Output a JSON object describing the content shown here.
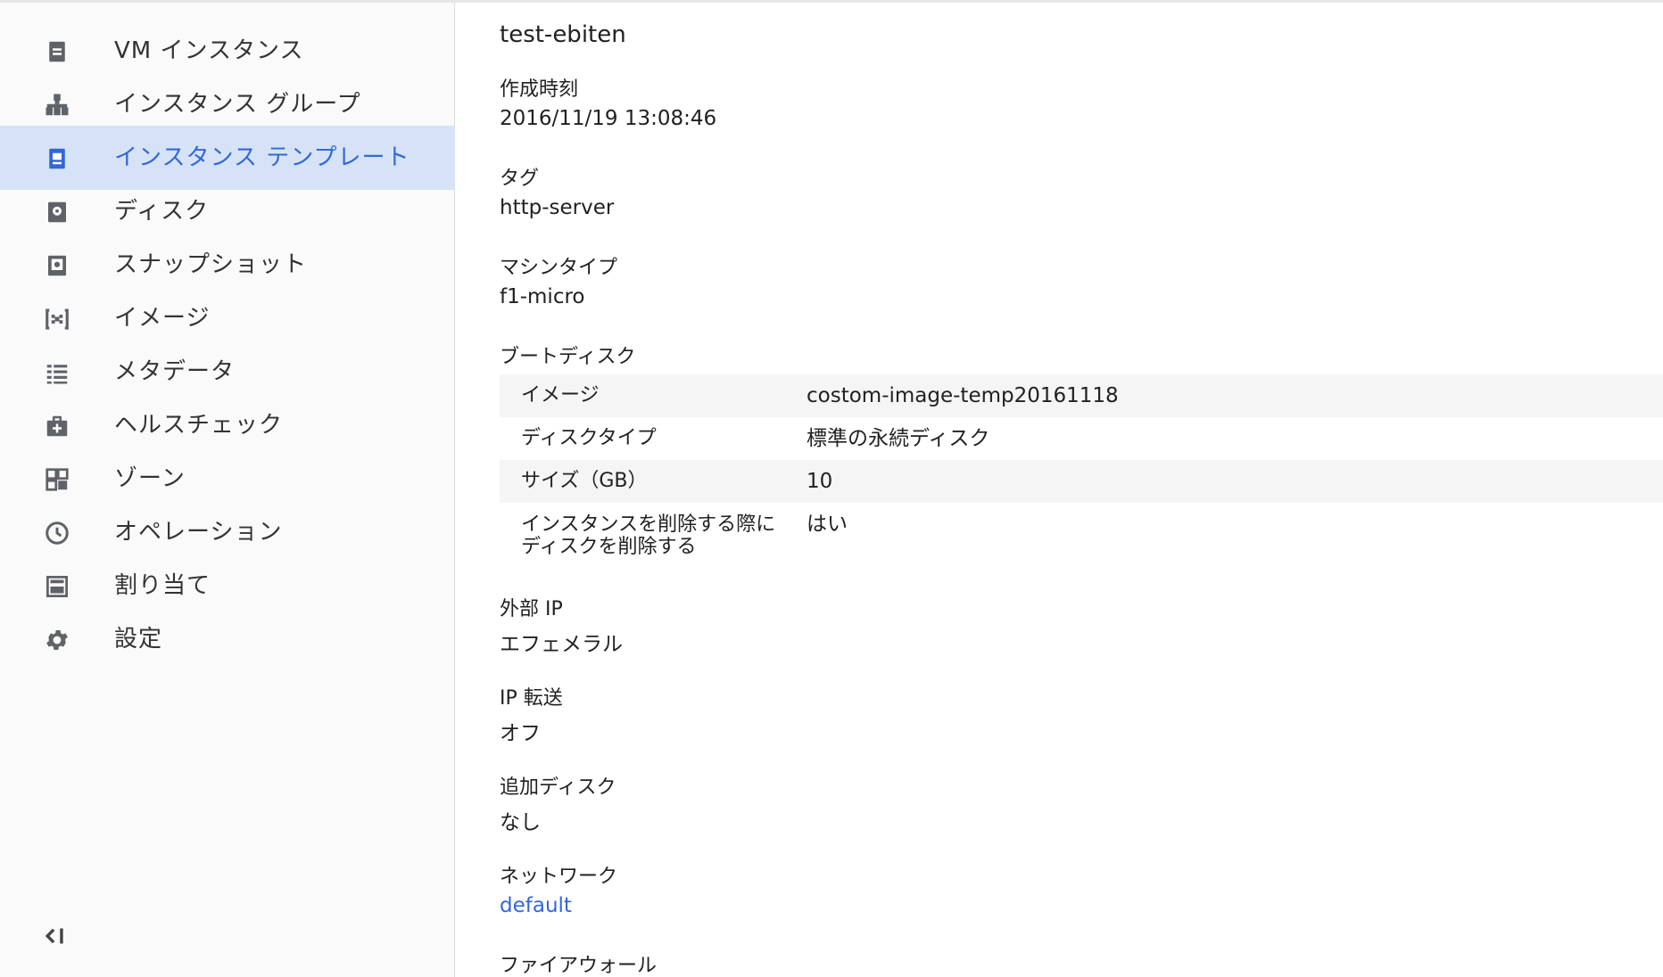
{
  "sidebar": {
    "items": [
      {
        "label": "VM インスタンス",
        "icon": "vm-instance-icon"
      },
      {
        "label": "インスタンス グループ",
        "icon": "instance-group-icon"
      },
      {
        "label": "インスタンス テンプレート",
        "icon": "instance-template-icon",
        "active": true
      },
      {
        "label": "ディスク",
        "icon": "disk-icon"
      },
      {
        "label": "スナップショット",
        "icon": "snapshot-icon"
      },
      {
        "label": "イメージ",
        "icon": "image-icon"
      },
      {
        "label": "メタデータ",
        "icon": "metadata-icon"
      },
      {
        "label": "ヘルスチェック",
        "icon": "health-check-icon"
      },
      {
        "label": "ゾーン",
        "icon": "zone-icon"
      },
      {
        "label": "オペレーション",
        "icon": "clock-icon"
      },
      {
        "label": "割り当て",
        "icon": "quota-icon"
      },
      {
        "label": "設定",
        "icon": "gear-icon"
      }
    ],
    "collapse_icon": "collapse-sidebar-icon"
  },
  "main": {
    "title": "test-ebiten",
    "created": {
      "label": "作成時刻",
      "value": "2016/11/19 13:08:46"
    },
    "tags": {
      "label": "タグ",
      "value": "http-server"
    },
    "machine_type": {
      "label": "マシンタイプ",
      "value": "f1-micro"
    },
    "boot_disk": {
      "label": "ブートディスク",
      "rows": [
        {
          "key": "イメージ",
          "value": "costom-image-temp20161118"
        },
        {
          "key": "ディスクタイプ",
          "value": "標準の永続ディスク"
        },
        {
          "key": "サイズ（GB）",
          "value": "10"
        },
        {
          "key": "インスタンスを削除する際にディスクを削除する",
          "value": "はい"
        }
      ]
    },
    "external_ip": {
      "label": "外部 IP",
      "value": "エフェメラル"
    },
    "ip_forwarding": {
      "label": "IP 転送",
      "value": "オフ"
    },
    "additional_disks": {
      "label": "追加ディスク",
      "value": "なし"
    },
    "network": {
      "label": "ネットワーク",
      "value": "default"
    },
    "firewall": {
      "label": "ファイアウォール"
    }
  },
  "colors": {
    "accent": "#3367d6",
    "active_bg": "#d6e3f7",
    "sidebar_bg": "#fafafa",
    "icon": "#5f6368"
  }
}
